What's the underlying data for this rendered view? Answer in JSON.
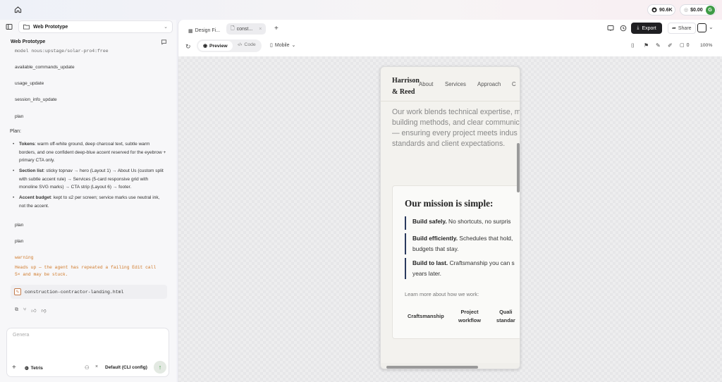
{
  "topbar": {
    "stars": "90.6K",
    "credits": "$0.00",
    "avatar_letter": "G"
  },
  "left": {
    "project_title": "Web Prototype",
    "panel_title": "Web Prototype",
    "model_line": "model nous:upstage/solar-pro4:free",
    "events": [
      "available_commands_update",
      "usage_update",
      "session_info_update",
      "plan"
    ],
    "plan_heading": "Plan:",
    "bullets": [
      {
        "bold": "Tokens",
        "text": ": warm off-white ground, deep charcoal text, subtle warm borders, and one confident deep-blue accent reserved for the eyebrow + primary CTA only."
      },
      {
        "bold": "Section list",
        "text": ": sticky topnav → hero (Layout 1) → About Us (custom split with subtle accent rule) → Services (5-card responsive grid with monoline SVG marks) → CTA strip (Layout 6) → footer."
      },
      {
        "bold": "Accent budget",
        "text": ": kept to ≤2 per screen; service marks use neutral ink, not the accent."
      }
    ],
    "plan2": "plan",
    "plan3": "plan",
    "warning_label": "warning",
    "warning_text": "Heads up — the agent has repeated a failing Edit call 5× and may be stuck.",
    "file_chip": "construction-contractor-landing.html",
    "input_placeholder": "Genera",
    "tetris_label": "Tetris",
    "model_select": "Default (CLI config)"
  },
  "right": {
    "tabs": [
      "Design Fi...",
      "const..."
    ],
    "export_label": "Export",
    "share_label": "Share",
    "preview_label": "Preview",
    "code_label": "Code",
    "device_label": "Mobile",
    "comment_count": "0",
    "zoom": "100%"
  },
  "phone": {
    "brand_line1": "Harrison",
    "brand_line2": "& Reed",
    "nav": [
      "About",
      "Services",
      "Approach",
      "C"
    ],
    "body_lines": [
      "Our work blends technical expertise, m",
      "building methods, and clear communic",
      "— ensuring every project meets indus",
      "standards and client expectations."
    ],
    "mission_title": "Our mission is simple:",
    "mission_items": [
      {
        "bold": "Build safely.",
        "lines": [
          " No shortcuts, no surpris"
        ]
      },
      {
        "bold": "Build efficiently.",
        "lines": [
          " Schedules that hold,",
          "budgets that stay."
        ]
      },
      {
        "bold": "Build to last.",
        "lines": [
          " Craftsmanship you can s",
          "years later."
        ]
      }
    ],
    "learn_more": "Learn more about how we work:",
    "links": [
      [
        "Craftsmanship"
      ],
      [
        "Project",
        "workflow"
      ],
      [
        "Quali",
        "standar"
      ]
    ]
  },
  "colors": {
    "accent_green": "#3e9b45",
    "mission_rule": "#2a3a5e",
    "warning": "#d07a2a"
  }
}
